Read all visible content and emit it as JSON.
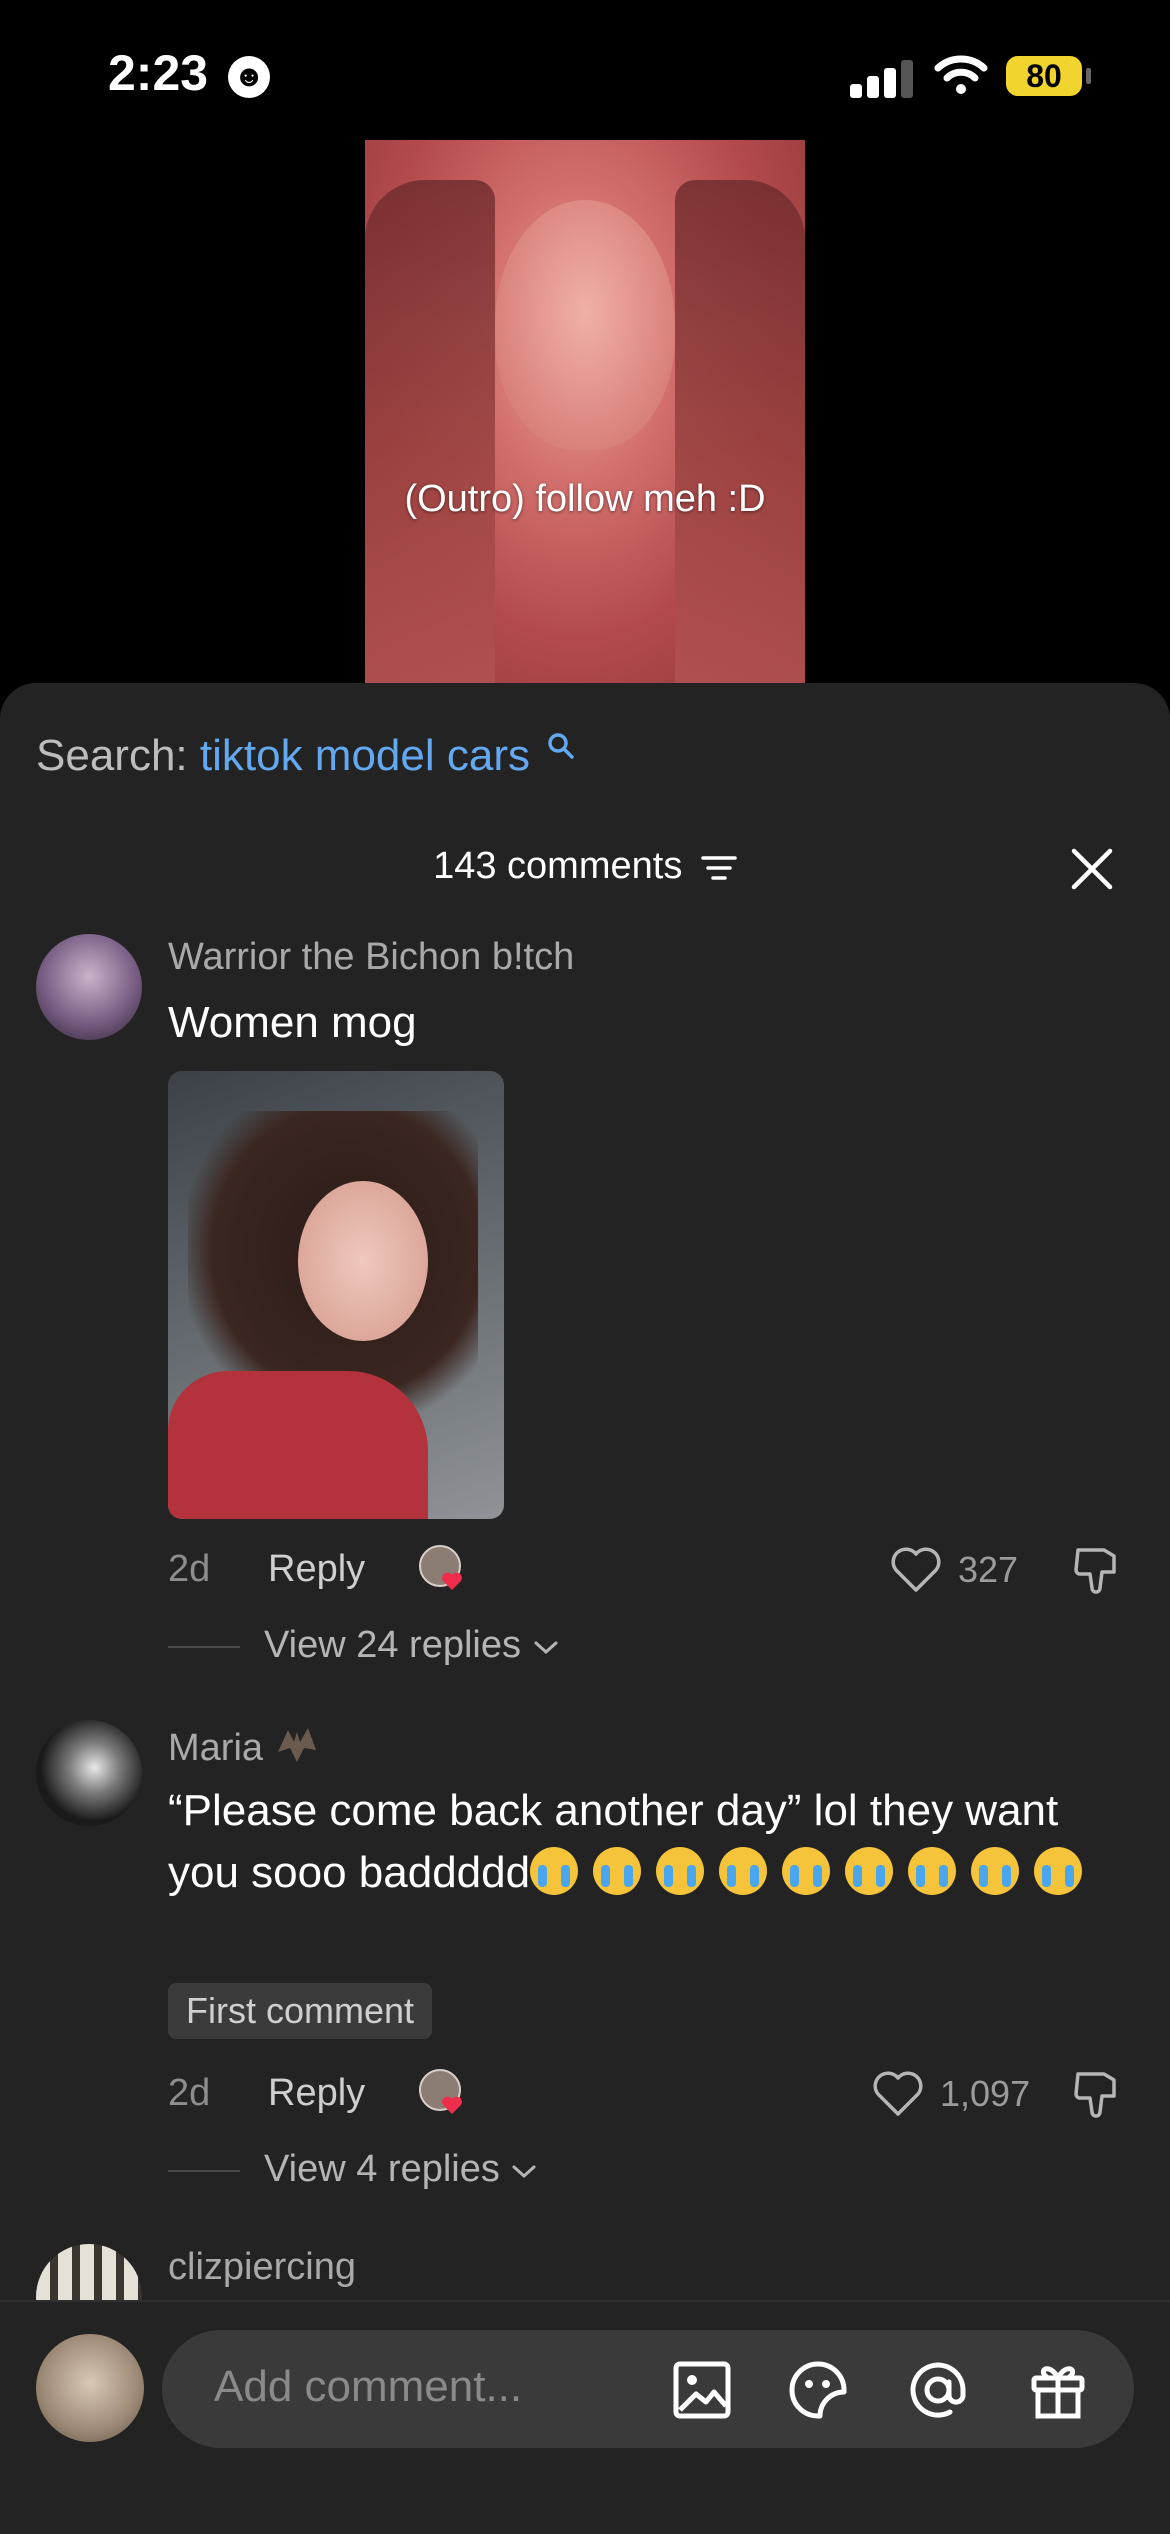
{
  "status_bar": {
    "time": "2:23",
    "battery": "80"
  },
  "video": {
    "caption": "(Outro) follow meh :D"
  },
  "search": {
    "prefix": "Search:",
    "term": "tiktok model cars"
  },
  "comments_header": {
    "count_label": "143 comments"
  },
  "comments": [
    {
      "username": "Warrior the Bichon b!tch",
      "text": "Women mog",
      "age": "2d",
      "reply_label": "Reply",
      "likes": "327",
      "view_replies": "View 24 replies"
    },
    {
      "username": "Maria",
      "text": "“Please come back another day” lol they want you sooo baddddd",
      "badge": "First comment",
      "age": "2d",
      "reply_label": "Reply",
      "likes": "1,097",
      "view_replies": "View 4 replies"
    },
    {
      "username": "clizpiercing"
    }
  ],
  "composer": {
    "placeholder": "Add comment..."
  },
  "colors": {
    "sheet_bg": "#232323",
    "link_blue": "#63a9f2",
    "battery_yellow": "#f2d42f",
    "heart_red": "#ee2e4a"
  },
  "icons": [
    "smiley-icon",
    "signal-icon",
    "wifi-icon",
    "battery-icon",
    "search-icon",
    "filter-icon",
    "close-icon",
    "heart-icon",
    "dislike-icon",
    "chevron-down-icon",
    "image-icon",
    "sticker-icon",
    "mention-icon",
    "gift-icon",
    "bat-emoji-icon",
    "crying-emoji-icon"
  ]
}
